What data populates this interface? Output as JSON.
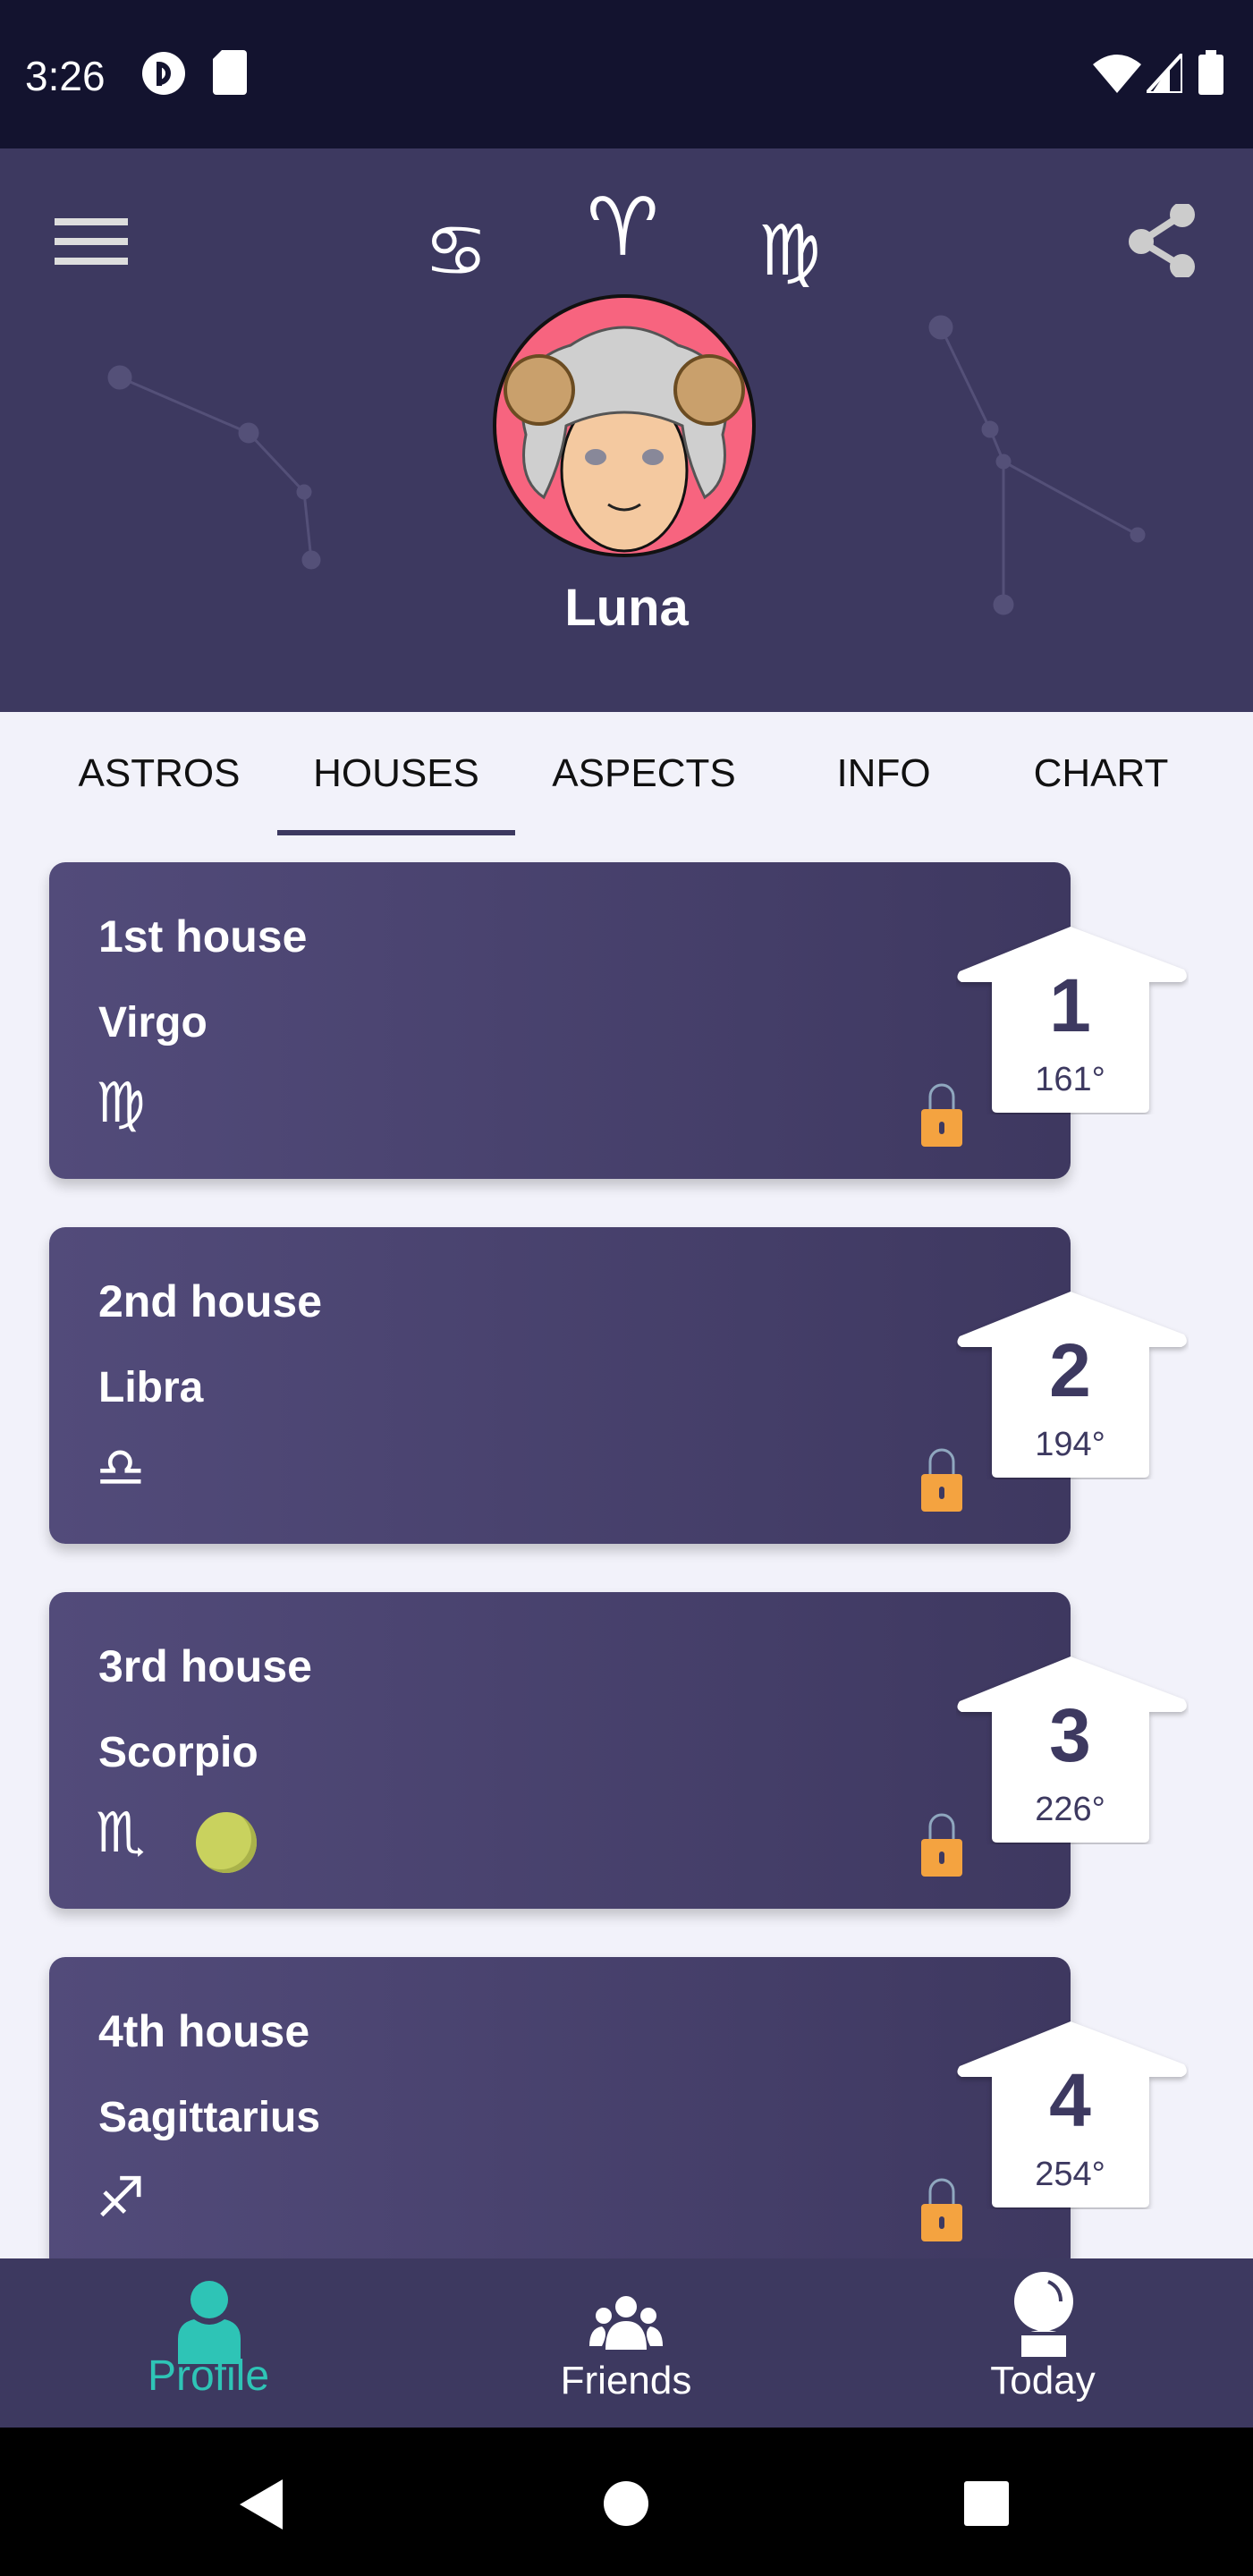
{
  "status_bar": {
    "time": "3:26",
    "icons": [
      "pocket-casts-icon",
      "sd-card-icon",
      "wifi-icon",
      "signal-icon",
      "battery-icon"
    ]
  },
  "header": {
    "menu_icon": "hamburger-menu-icon",
    "share_icon": "share-icon",
    "signs": {
      "left": "♋︎",
      "center": "♈︎",
      "right": "♍︎"
    },
    "sign_names": [
      "cancer-icon",
      "aries-icon",
      "virgo-icon"
    ],
    "profile_name": "Luna"
  },
  "tabs": {
    "items": [
      "ASTROS",
      "HOUSES",
      "ASPECTS",
      "INFO",
      "CHART"
    ],
    "active": "HOUSES"
  },
  "houses": [
    {
      "title": "1st house",
      "sign": "Virgo",
      "glyph": "♍︎",
      "number": "1",
      "degree": "161°",
      "locked": true
    },
    {
      "title": "2nd house",
      "sign": "Libra",
      "glyph": "♎︎",
      "number": "2",
      "degree": "194°",
      "locked": true
    },
    {
      "title": "3rd house",
      "sign": "Scorpio",
      "glyph": "♏︎",
      "number": "3",
      "degree": "226°",
      "locked": true,
      "planet_icon": "planet-icon"
    },
    {
      "title": "4th house",
      "sign": "Sagittarius",
      "glyph": "♐︎",
      "number": "4",
      "degree": "254°",
      "locked": true
    }
  ],
  "bottom_nav": {
    "items": [
      "Profile",
      "Friends",
      "Today"
    ],
    "active": "Profile"
  },
  "colors": {
    "header": "#3d3960",
    "status_bar": "#13132f",
    "accent": "#2ec4b6",
    "lock": "#f4a340",
    "background": "#f2f2fa"
  }
}
